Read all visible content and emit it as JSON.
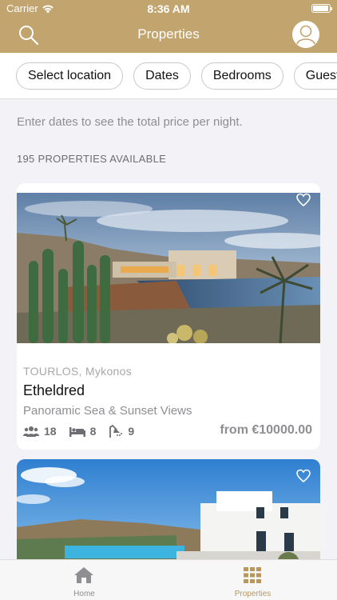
{
  "status_bar": {
    "carrier": "Carrier",
    "time": "8:36 AM"
  },
  "header": {
    "title": "Properties",
    "accent": "#c2a46f",
    "search_icon": "search-icon",
    "profile_icon": "user-avatar-icon"
  },
  "filters": [
    "Select location",
    "Dates",
    "Bedrooms",
    "Guests"
  ],
  "hint": "Enter dates to see the total price per night.",
  "available_count": "195 PROPERTIES AVAILABLE",
  "listings": [
    {
      "location": "TOURLOS, Mykonos",
      "name": "Etheldred",
      "tagline": "Panoramic Sea & Sunset Views",
      "guests": "18",
      "bedrooms": "8",
      "bathrooms": "9",
      "price": "from €10000.00"
    }
  ],
  "tabs": [
    {
      "label": "Home",
      "icon": "home-icon"
    },
    {
      "label": "Properties",
      "icon": "grid-icon"
    }
  ]
}
